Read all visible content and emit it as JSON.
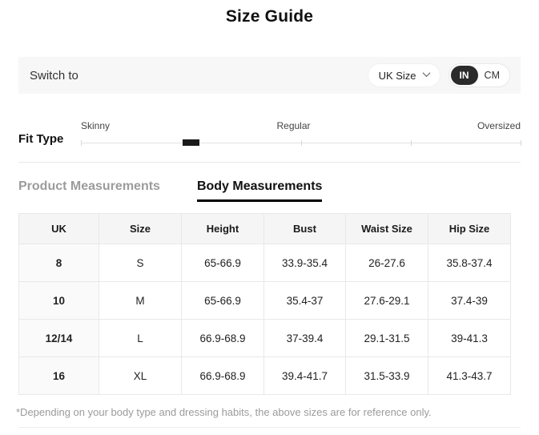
{
  "page": {
    "title": "Size Guide"
  },
  "switch_bar": {
    "label": "Switch to",
    "size_dropdown": {
      "value": "UK Size"
    },
    "unit_toggle": {
      "options": [
        "IN",
        "CM"
      ],
      "selected": "IN"
    }
  },
  "fit_type": {
    "label": "Fit Type",
    "options": [
      "Skinny",
      "Regular",
      "Oversized"
    ],
    "selected_percent": 25
  },
  "tabs": [
    {
      "label": "Product Measurements",
      "active": false
    },
    {
      "label": "Body Measurements",
      "active": true
    }
  ],
  "size_table": {
    "columns": [
      "UK",
      "Size",
      "Height",
      "Bust",
      "Waist Size",
      "Hip Size"
    ],
    "rows": [
      [
        "8",
        "S",
        "65-66.9",
        "33.9-35.4",
        "26-27.6",
        "35.8-37.4"
      ],
      [
        "10",
        "M",
        "65-66.9",
        "35.4-37",
        "27.6-29.1",
        "37.4-39"
      ],
      [
        "12/14",
        "L",
        "66.9-68.9",
        "37-39.4",
        "29.1-31.5",
        "39-41.3"
      ],
      [
        "16",
        "XL",
        "66.9-68.9",
        "39.4-41.7",
        "31.5-33.9",
        "41.3-43.7"
      ]
    ]
  },
  "footnote": "*Depending on your body type and dressing habits, the above sizes are for reference only.",
  "colors": {
    "accent_dark": "#2b2b2b",
    "bar_background": "#f7f7f7",
    "table_border": "#e8e8e8",
    "inactive_tab": "#9c9c9c",
    "footnote_gray": "#9b9b9b"
  }
}
